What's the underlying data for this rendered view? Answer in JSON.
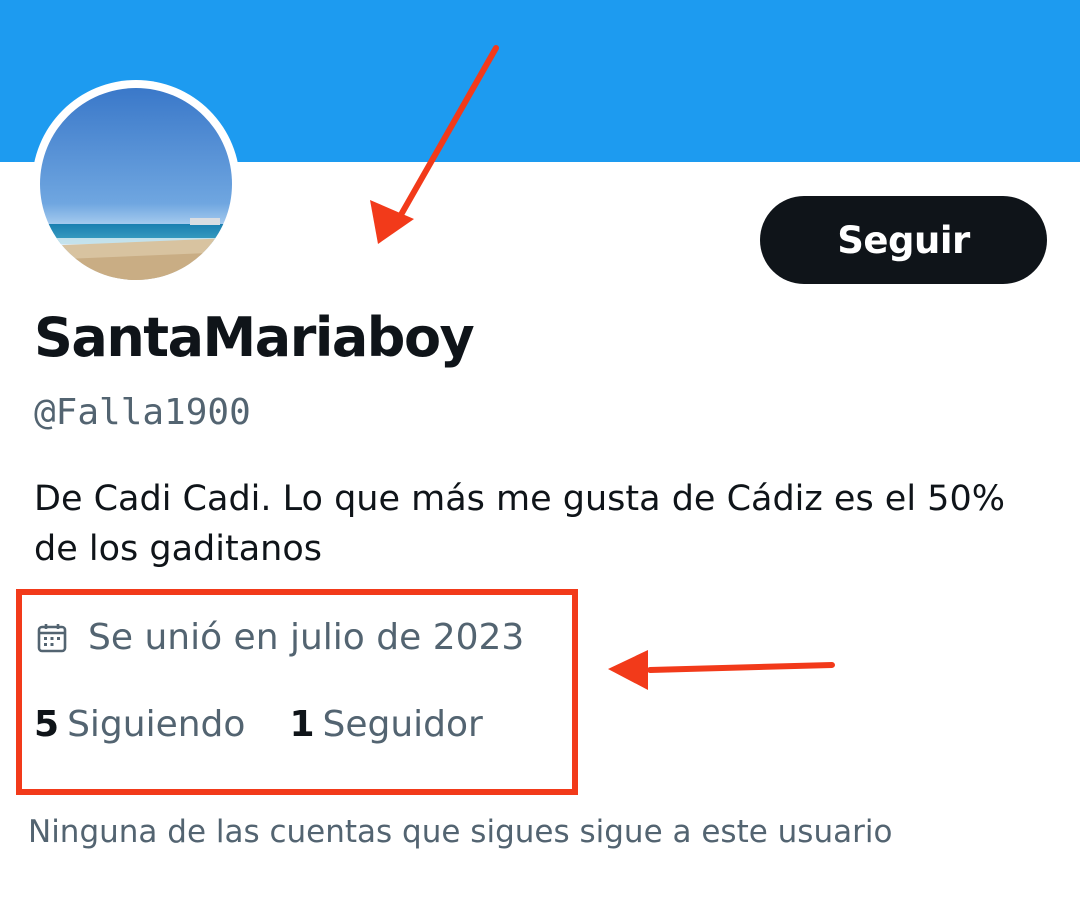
{
  "profile": {
    "display_name": "SantaMariaboy",
    "handle": "@Falla1900",
    "bio": "De Cadi Cadi. Lo que más me gusta de Cádiz es el 50% de los gaditanos",
    "joined": "Se unió en julio de 2023",
    "following_count": "5",
    "following_label": "Siguiendo",
    "followers_count": "1",
    "followers_label": "Seguidor",
    "followed_by_note": "Ninguna de las cuentas que sigues sigue a este usuario"
  },
  "actions": {
    "follow_label": "Seguir"
  },
  "icons": {
    "joined_icon": "calendar-icon"
  },
  "colors": {
    "banner": "#1d9bf0",
    "text_primary": "#0f1419",
    "text_secondary": "#536471",
    "follow_button": "#0f1419",
    "annotation": "#f23a1a"
  }
}
